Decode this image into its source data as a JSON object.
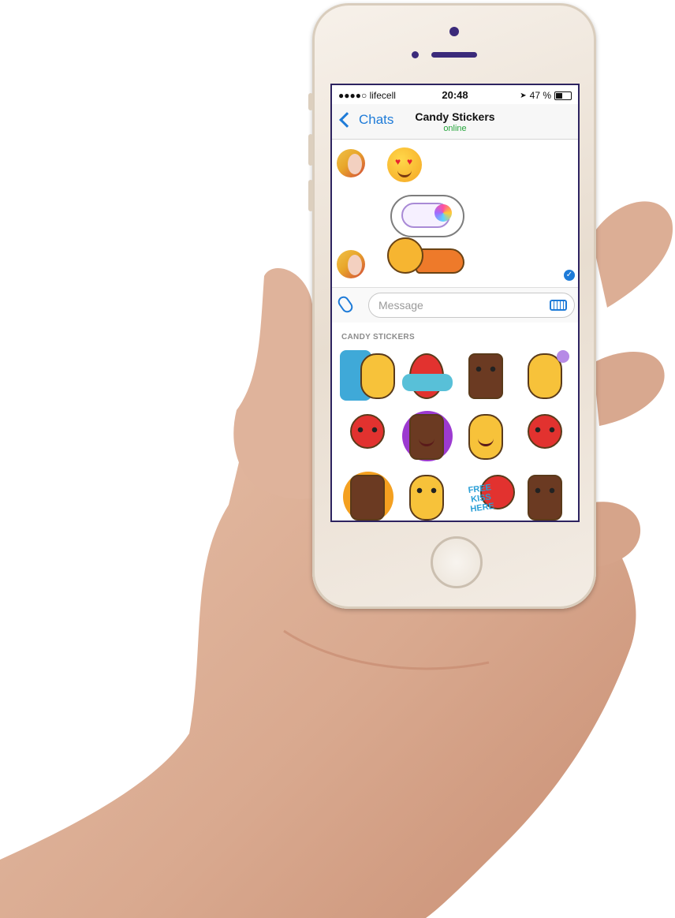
{
  "status_bar": {
    "carrier": "●●●●○ lifecell",
    "time": "20:48",
    "battery": "47 %",
    "battery_level": 0.47
  },
  "nav": {
    "back_label": "Chats",
    "title": "Candy Stickers",
    "subtitle": "online"
  },
  "composer": {
    "placeholder": "Message"
  },
  "sticker_panel": {
    "title": "CANDY STICKERS",
    "stickers": [
      {
        "text": ""
      },
      {
        "text": ""
      },
      {
        "text": ""
      },
      {
        "text": ""
      },
      {
        "text": ""
      },
      {
        "text": ""
      },
      {
        "text": ""
      },
      {
        "text": ""
      },
      {
        "text": ""
      },
      {
        "text": ""
      },
      {
        "text": "FREE KISS HERE"
      },
      {
        "text": ""
      }
    ]
  },
  "colors": {
    "accent": "#1e7bd8",
    "online": "#26a53c",
    "phone_body": "#f0e8de"
  },
  "icons": {
    "back": "chevron-left-icon",
    "location": "location-arrow-icon",
    "attach": "paperclip-icon",
    "keyboard": "keyboard-icon",
    "read": "check-icon"
  }
}
